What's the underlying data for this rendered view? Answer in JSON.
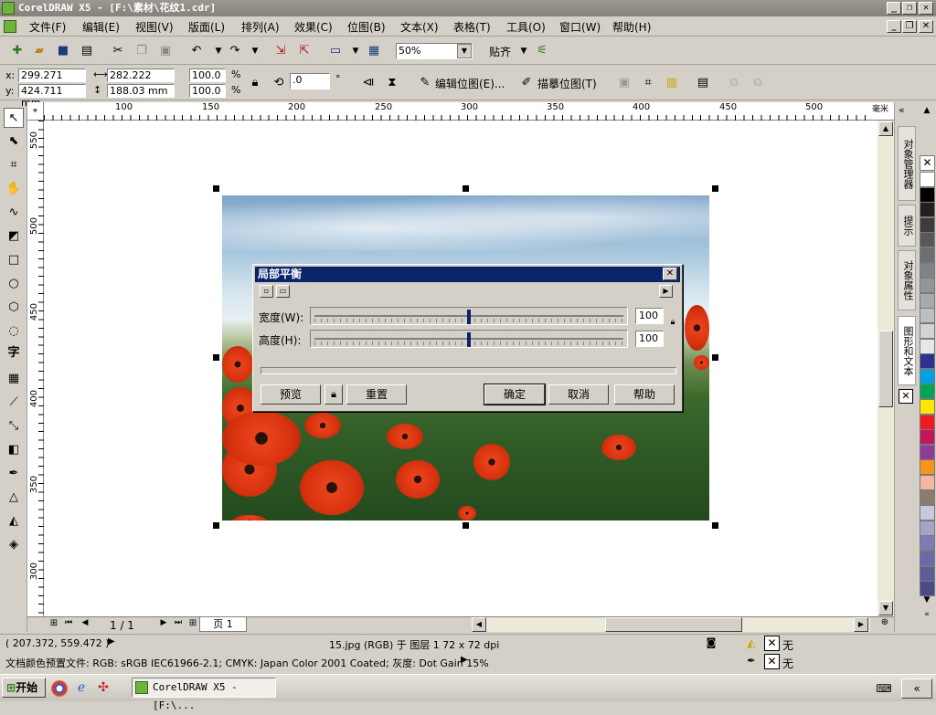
{
  "window": {
    "title": "CorelDRAW X5 - [F:\\素材\\花纹1.cdr]",
    "minimize": "_",
    "restore": "❐",
    "close": "✕"
  },
  "menu": [
    "文件(F)",
    "编辑(E)",
    "视图(V)",
    "版面(L)",
    "排列(A)",
    "效果(C)",
    "位图(B)",
    "文本(X)",
    "表格(T)",
    "工具(O)",
    "窗口(W)",
    "帮助(H)"
  ],
  "toolbar": {
    "zoom": "50%",
    "snap_label": "贴齐"
  },
  "propbar": {
    "x_label": "x:",
    "x_value": "299.271 mm",
    "y_label": "y:",
    "y_value": "424.711 mm",
    "w_value": "282.222 mm",
    "h_value": "188.03 mm",
    "scale_w": "100.0",
    "scale_h": "100.0",
    "percent": "%",
    "rotation": ".0",
    "degree": "°",
    "edit_bitmap": "编辑位图(E)...",
    "trace_bitmap": "描摹位图(T)"
  },
  "ruler": {
    "h_ticks": [
      "100",
      "150",
      "200",
      "250",
      "300",
      "350",
      "400",
      "450",
      "500"
    ],
    "v_ticks": [
      "550",
      "500",
      "450",
      "400",
      "350",
      "300"
    ],
    "unit": "毫米"
  },
  "dialog": {
    "title": "局部平衡",
    "width_label": "宽度(W):",
    "width_value": "100",
    "width_level": 0.5,
    "height_label": "高度(H):",
    "height_value": "100",
    "height_level": 0.5,
    "preview": "预览",
    "reset": "重置",
    "ok": "确定",
    "cancel": "取消",
    "help": "帮助"
  },
  "page_nav": {
    "page_count": "1 / 1",
    "page_tab": "页 1"
  },
  "dockers": {
    "object_manager": "对象管理器",
    "hints": "提示",
    "object_properties": "对象属性",
    "shape_text": "图形和文本"
  },
  "status": {
    "coords": "( 207.372, 559.472 )",
    "object_info": "15.jpg (RGB) 于 图层 1 72 x 72 dpi",
    "fill_label": "无",
    "outline_label": "无",
    "color_profile": "文档颜色预置文件: RGB: sRGB IEC61966-2.1; CMYK: Japan Color 2001 Coated; 灰度: Dot Gain 15%"
  },
  "taskbar": {
    "start": "开始",
    "task_item": "CorelDRAW X5 - [F:\\..."
  },
  "palette": [
    "#ffffff",
    "#000000",
    "#231f20",
    "#3d3b3c",
    "#58585a",
    "#6d6e70",
    "#808285",
    "#939598",
    "#a7a9ac",
    "#bcbec0",
    "#d1d3d4",
    "#e6e7e8",
    "#2e3192",
    "#00a1e4",
    "#00a651",
    "#ffe600",
    "#ed1c24",
    "#c2185b",
    "#8e3c97",
    "#f7941d",
    "#f4b6a3",
    "#8b7d6b",
    "#c8c8e0",
    "#a6a2c9",
    "#7f7bb3",
    "#6a6aa8",
    "#5c5c98",
    "#4a4a8a"
  ]
}
